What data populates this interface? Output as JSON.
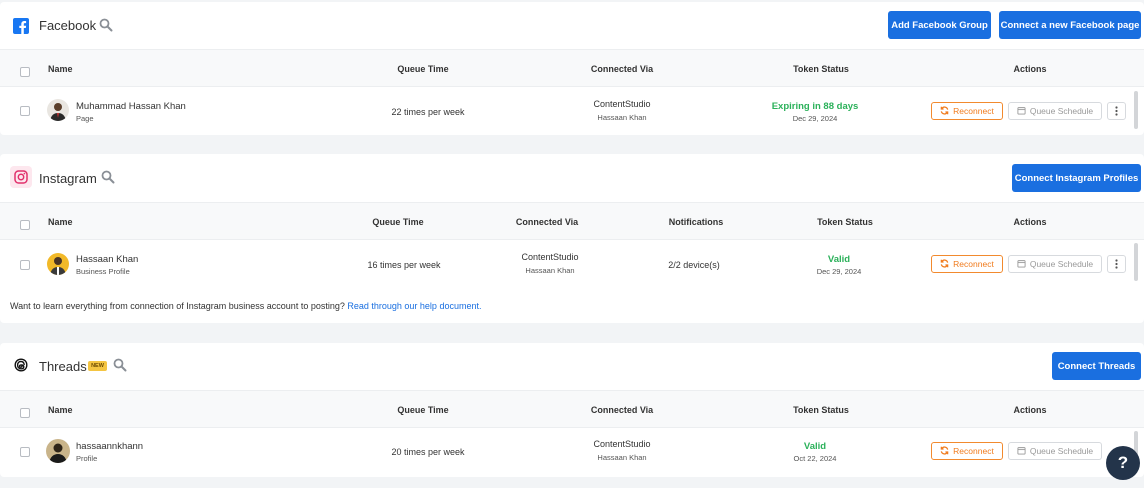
{
  "facebook": {
    "title": "Facebook",
    "icon": "facebook-icon",
    "add_group_label": "Add Facebook Group",
    "connect_label": "Connect a new Facebook page",
    "columns": {
      "name": "Name",
      "queue_time": "Queue Time",
      "connected_via": "Connected Via",
      "token_status": "Token Status",
      "actions": "Actions"
    },
    "rows": [
      {
        "name": "Muhammad Hassan Khan",
        "type": "Page",
        "queue_time": "22 times per week",
        "via": "ContentStudio",
        "via_user": "Hassaan Khan",
        "status": "Expiring in 88 days",
        "status_date": "Dec 29, 2024",
        "reconnect": "Reconnect",
        "queue_schedule": "Queue Schedule"
      }
    ]
  },
  "instagram": {
    "title": "Instagram",
    "icon": "instagram-icon",
    "connect_label": "Connect Instagram Profiles",
    "columns": {
      "name": "Name",
      "queue_time": "Queue Time",
      "connected_via": "Connected Via",
      "notifications": "Notifications",
      "token_status": "Token Status",
      "actions": "Actions"
    },
    "rows": [
      {
        "name": "Hassaan Khan",
        "type": "Business Profile",
        "queue_time": "16 times per week",
        "via": "ContentStudio",
        "via_user": "Hassaan Khan",
        "notifications": "2/2 device(s)",
        "status": "Valid",
        "status_date": "Dec 29, 2024",
        "reconnect": "Reconnect",
        "queue_schedule": "Queue Schedule"
      }
    ],
    "help_text": "Want to learn everything from connection of Instagram business account to posting?",
    "help_link": "Read through our help document."
  },
  "threads": {
    "title": "Threads",
    "badge": "NEW",
    "icon": "threads-icon",
    "connect_label": "Connect Threads",
    "columns": {
      "name": "Name",
      "queue_time": "Queue Time",
      "connected_via": "Connected Via",
      "token_status": "Token Status",
      "actions": "Actions"
    },
    "rows": [
      {
        "name": "hassaannkhann",
        "type": "Profile",
        "queue_time": "20 times per week",
        "via": "ContentStudio",
        "via_user": "Hassaan Khan",
        "status": "Valid",
        "status_date": "Oct 22, 2024",
        "reconnect": "Reconnect",
        "queue_schedule": "Queue Schedule"
      }
    ]
  },
  "help_button": "?",
  "colors": {
    "primary": "#1a6fe0",
    "valid": "#2bb15a",
    "reconnect": "#f07b1d",
    "help_fab": "#23344a"
  }
}
